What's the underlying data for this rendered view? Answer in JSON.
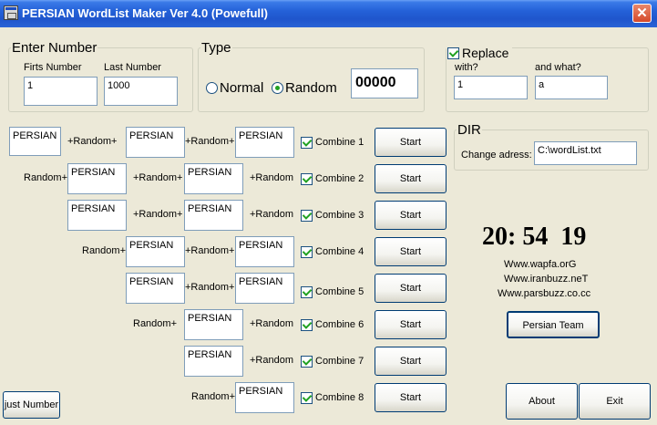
{
  "window": {
    "title": "PERSIAN WordList Maker Ver 4.0 (Powefull)",
    "close_glyph": "✕"
  },
  "enter_number": {
    "legend": "Enter Number",
    "first_label": "Firts Number",
    "first_value": "1",
    "last_label": "Last Number",
    "last_value": "1000"
  },
  "type": {
    "legend": "Type",
    "normal_label": "Normal",
    "random_label": "Random",
    "selected": "Random",
    "digits_value": "00000"
  },
  "replace": {
    "legend": "Replace",
    "checked": true,
    "with_label": "with?",
    "with_value": "1",
    "what_label": "and what?",
    "what_value": "a"
  },
  "dir": {
    "legend": "DIR",
    "change_label": "Change adress:",
    "path_value": "C:\\wordList.txt"
  },
  "rows": [
    {
      "prefix": "",
      "tb1": "PERSIAN",
      "mid": "+Random+",
      "tb2": "PERSIAN",
      "mid2": "+Random+",
      "tb3": "PERSIAN",
      "combine": "Combine 1",
      "start": "Start"
    },
    {
      "prefix": "Random+",
      "tb1": "PERSIAN",
      "mid": "+Random+",
      "tb2": "PERSIAN",
      "mid2": "+Random",
      "combine": "Combine 2",
      "start": "Start"
    },
    {
      "tb1": "PERSIAN",
      "mid": "+Random+",
      "tb2": "PERSIAN",
      "mid2": "+Random",
      "combine": "Combine 3",
      "start": "Start"
    },
    {
      "prefix": "Random+",
      "tb1": "PERSIAN",
      "mid": "+Random+",
      "tb2": "PERSIAN",
      "combine": "Combine 4",
      "start": "Start"
    },
    {
      "tb1": "PERSIAN",
      "mid": "+Random+",
      "tb2": "PERSIAN",
      "combine": "Combine 5",
      "start": "Start"
    },
    {
      "prefix": "Random+",
      "tb1": "PERSIAN",
      "mid2": "+Random",
      "combine": "Combine 6",
      "start": "Start"
    },
    {
      "tb1": "PERSIAN",
      "mid2": "+Random",
      "combine": "Combine 7",
      "start": "Start"
    },
    {
      "prefix": "Random+",
      "tb1": "PERSIAN",
      "combine": "Combine 8",
      "start": "Start"
    }
  ],
  "clock": {
    "hours": "20",
    "sep": ":",
    "minutes": "54",
    "seconds": "19"
  },
  "links": [
    "Www.wapfa.orG",
    "Www.iranbuzz.neT",
    "Www.parsbuzz.co.cc"
  ],
  "buttons": {
    "persian_team": "Persian Team",
    "about": "About",
    "exit": "Exit",
    "just_number": "just Number"
  }
}
